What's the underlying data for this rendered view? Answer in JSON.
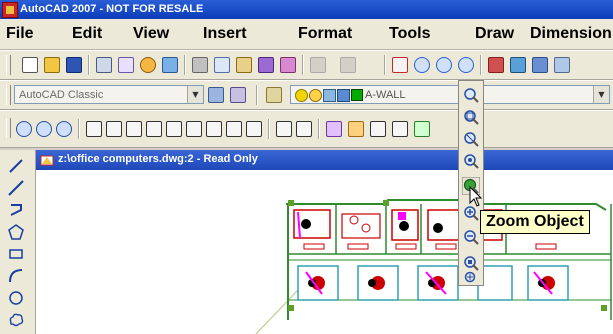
{
  "app": {
    "title": "AutoCAD 2007 - NOT FOR RESALE"
  },
  "menubar": {
    "items": [
      "File",
      "Edit",
      "View",
      "Insert",
      "Format",
      "Tools",
      "Draw",
      "Dimension"
    ]
  },
  "toolbar2": {
    "workspace_value": "AutoCAD Classic",
    "layer_value": "A-WALL"
  },
  "document": {
    "title": "z:\\office computers.dwg:2 - Read Only"
  },
  "tooltip": {
    "text": "Zoom Object"
  },
  "colors": {
    "titlebar": "#0b3cb8",
    "toolbar_bg": "#ece9d8",
    "tooltip_bg": "#ffffc8",
    "walls": "#2e8b2e",
    "furniture": "#cc0000",
    "chairs": "#ff00ff",
    "layer_swatch": "#00aa00"
  },
  "icons": [
    "app-icon",
    "zoom-realtime-icon",
    "zoom-window-icon",
    "zoom-dynamic-icon",
    "zoom-scale-icon",
    "zoom-center-icon",
    "zoom-object-icon",
    "zoom-in-icon",
    "zoom-out-icon",
    "zoom-all-icon",
    "zoom-extents-icon",
    "mouse-cursor-icon"
  ]
}
